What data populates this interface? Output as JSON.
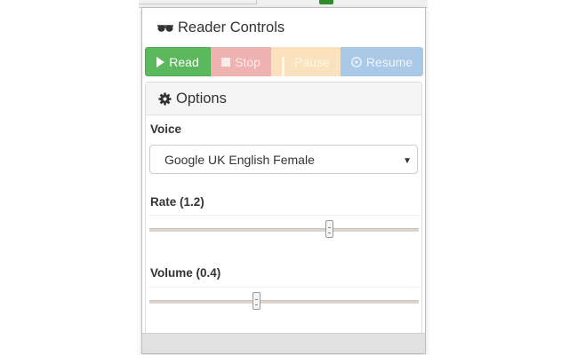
{
  "header": {
    "title": "Reader Controls",
    "icon": "glasses-icon"
  },
  "controls": {
    "read_label": "Read",
    "stop_label": "Stop",
    "pause_label": "Pause",
    "resume_label": "Resume",
    "colors": {
      "read": "#5cb85c",
      "stop": "#eeb2b0",
      "pause": "#f9e2bd",
      "resume": "#a9c9e6"
    }
  },
  "options": {
    "title": "Options",
    "icon": "gear-icon",
    "voice": {
      "label": "Voice",
      "selected": "Google UK English Female"
    },
    "rate": {
      "label": "Rate (1.2)",
      "value": 1.2,
      "fraction": 0.67
    },
    "volume": {
      "label": "Volume (0.4)",
      "value": 0.4,
      "fraction": 0.4
    }
  }
}
